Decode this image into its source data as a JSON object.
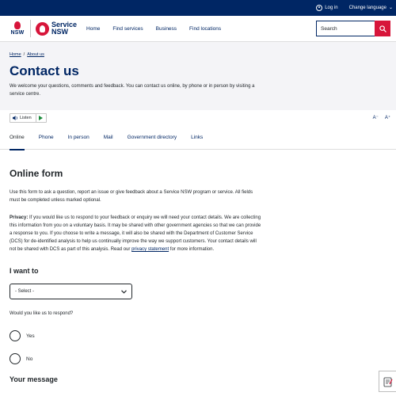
{
  "topbar": {
    "login_label": "Log in",
    "language_label": "Change language"
  },
  "header": {
    "logo_nsw": "NSW",
    "logo_service_line1": "Service",
    "logo_service_line2": "NSW",
    "nav": [
      "Home",
      "Find services",
      "Business",
      "Find locations"
    ],
    "search_placeholder": "Search"
  },
  "breadcrumb": {
    "home": "Home",
    "separator": "/",
    "about": "About us"
  },
  "hero": {
    "title": "Contact us",
    "intro": "We welcome your questions, comments and feedback. You can contact us online, by phone or in person by visiting a service centre."
  },
  "toolbar": {
    "listen_label": "Listen",
    "font_decrease": "A⁻",
    "font_increase": "A⁺"
  },
  "tabs": [
    "Online",
    "Phone",
    "In person",
    "Mail",
    "Government directory",
    "Links"
  ],
  "form": {
    "title": "Online form",
    "intro": "Use this form to ask a question, report an issue or give feedback about a Service NSW program or service. All fields must be completed unless marked optional.",
    "privacy_label": "Privacy:",
    "privacy_text": "If you would like us to respond to your feedback or enquiry we will need your contact details. We are collecting this information from you on a voluntary basis. It may be shared with other government agencies so that we can provide a response to you. If you choose to write a message, it will also be shared with the Department of Customer Service (DCS) for de-identified analysis to help us continually improve the way we support customers. Your contact details will not be shared with DCS as part of this analysis. Read our",
    "privacy_link": "privacy statement",
    "privacy_end": "for more information.",
    "want_label": "I want to",
    "select_value": "- Select -",
    "respond_question": "Would you like us to respond?",
    "options": [
      "Yes",
      "No"
    ],
    "message_label": "Your message"
  },
  "colors": {
    "navy": "#002664",
    "red": "#d7153a",
    "hero_bg": "#f4f4f7"
  }
}
